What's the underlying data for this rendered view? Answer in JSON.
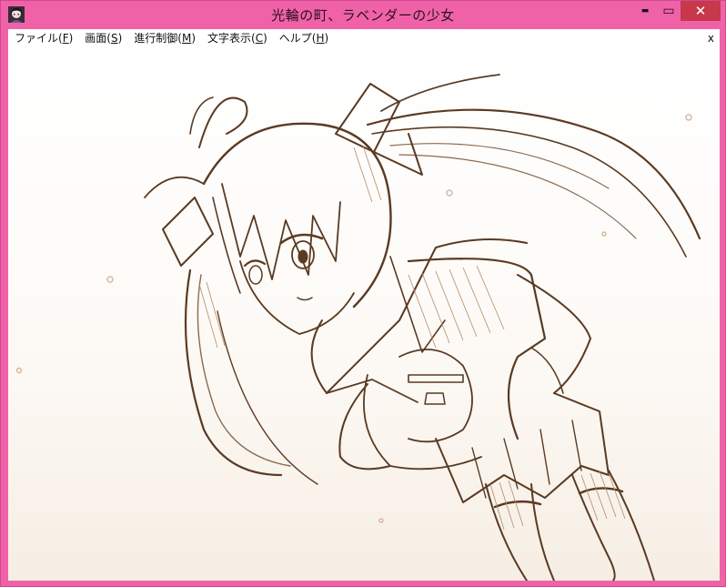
{
  "window": {
    "title": "光輪の町、ラベンダーの少女",
    "minimize_glyph": "▬",
    "maximize_glyph": "▭",
    "close_glyph": "✕",
    "icon": "app-character-icon",
    "frame_color": "#f062a8",
    "close_color": "#c7384a"
  },
  "menubar": {
    "items": [
      {
        "label": "ファイル(",
        "accel": "F",
        "tail": ")"
      },
      {
        "label": "画面(",
        "accel": "S",
        "tail": ")"
      },
      {
        "label": "進行制御(",
        "accel": "M",
        "tail": ")"
      },
      {
        "label": "文字表示(",
        "accel": "C",
        "tail": ")"
      },
      {
        "label": "ヘルプ(",
        "accel": "H",
        "tail": ")"
      }
    ],
    "close_label": "x"
  },
  "scene": {
    "description_icon": "sepia-character-illustration",
    "line_color": "#5a3a22",
    "tone_color": "#b58a66"
  }
}
